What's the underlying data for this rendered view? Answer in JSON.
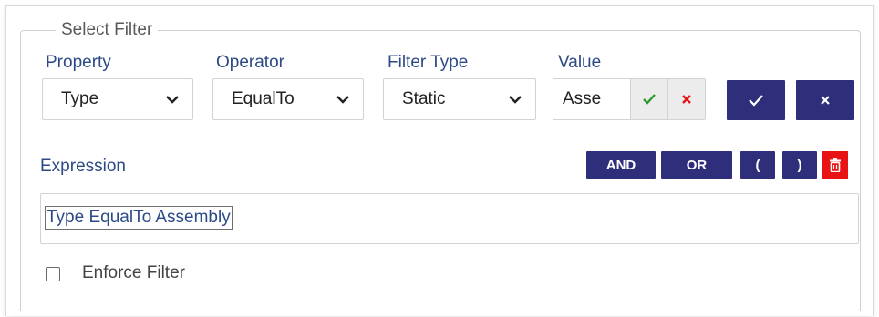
{
  "panel": {
    "legend": "Select Filter"
  },
  "property": {
    "label": "Property",
    "selected": "Type"
  },
  "operator": {
    "label": "Operator",
    "selected": "EqualTo"
  },
  "filter_type": {
    "label": "Filter Type",
    "selected": "Static"
  },
  "value": {
    "label": "Value",
    "current": "Asse"
  },
  "expression": {
    "label": "Expression",
    "text": "Type EqualTo Assembly",
    "and_label": "AND",
    "or_label": "OR",
    "open_paren_label": "(",
    "close_paren_label": ")"
  },
  "enforce_filter": {
    "label": "Enforce Filter",
    "checked": false
  },
  "colors": {
    "accent": "#2e2e7a",
    "label_blue": "#2c4a86",
    "confirm_green": "#2a9a2a",
    "cancel_red": "#e81414"
  },
  "icons": [
    "chevron-down-icon",
    "check-icon",
    "close-icon",
    "trash-icon"
  ]
}
